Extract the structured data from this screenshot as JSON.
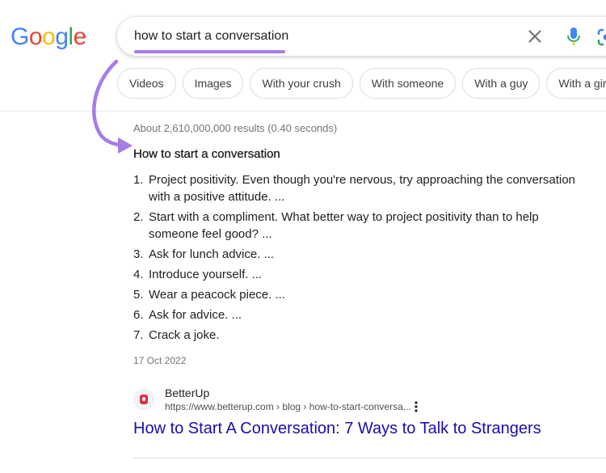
{
  "logo": {
    "letters": [
      "G",
      "o",
      "o",
      "g",
      "l",
      "e"
    ],
    "colors": [
      "#4285F4",
      "#EA4335",
      "#FBBC05",
      "#4285F4",
      "#34A853",
      "#EA4335"
    ]
  },
  "search": {
    "query": "how to start a conversation"
  },
  "icons": {
    "clear": "close-icon",
    "voice": "microphone-icon",
    "lens": "camera-lens-icon",
    "more": "more-vert-icon",
    "arrow": "curved-arrow-annotation"
  },
  "chips": [
    {
      "label": "Videos"
    },
    {
      "label": "Images"
    },
    {
      "label": "With your crush"
    },
    {
      "label": "With someone"
    },
    {
      "label": "With a guy"
    },
    {
      "label": "With a girl"
    }
  ],
  "results": {
    "stats": "About 2,610,000,000 results (0.40 seconds)",
    "snippet": {
      "title": "How to start a conversation",
      "items": [
        {
          "num": "1.",
          "text": "Project positivity. Even though you're nervous, try approaching the conversation with a positive attitude. ..."
        },
        {
          "num": "2.",
          "text": "Start with a compliment. What better way to project positivity than to help someone feel good? ..."
        },
        {
          "num": "3.",
          "text": "Ask for lunch advice. ..."
        },
        {
          "num": "4.",
          "text": "Introduce yourself. ..."
        },
        {
          "num": "5.",
          "text": "Wear a peacock piece. ..."
        },
        {
          "num": "6.",
          "text": "Ask for advice. ..."
        },
        {
          "num": "7.",
          "text": "Crack a joke."
        }
      ],
      "date": "17 Oct 2022"
    },
    "source": {
      "site_name": "BetterUp",
      "url": "https://www.betterup.com › blog › how-to-start-conversa...",
      "link_title": "How to Start A Conversation: 7 Ways to Talk to Strangers"
    }
  },
  "colors": {
    "accent_purple": "#a57ce8",
    "link_blue": "#1a0dab",
    "favicon_red": "#d9304b"
  }
}
